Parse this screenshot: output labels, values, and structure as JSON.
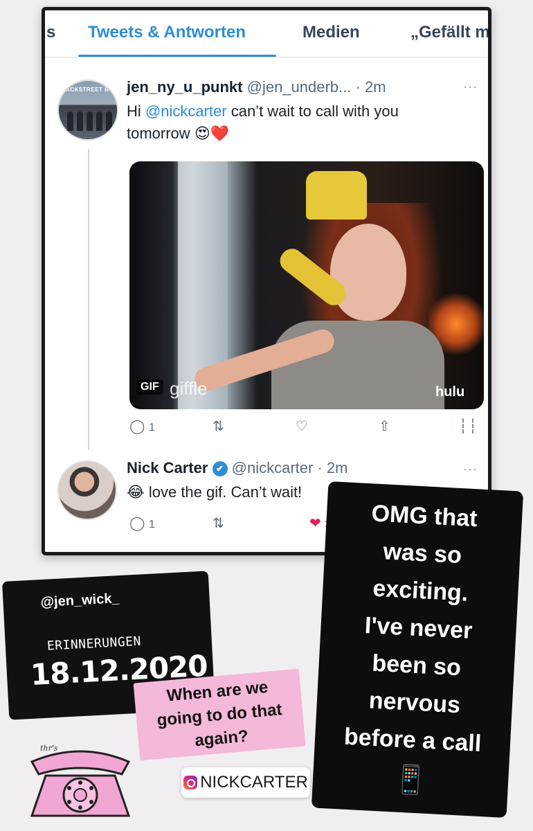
{
  "tabs": {
    "left_partial": "s",
    "tweets_replies": "Tweets & Antworten",
    "media": "Medien",
    "likes_partial": "„Gefällt m"
  },
  "tweet1": {
    "avatar_banner": "ACKSTREET B",
    "display_name": "jen_ny_u_punkt",
    "handle": "@jen_underb...",
    "time": "· 2m",
    "more": "···",
    "text_before": "Hi ",
    "mention": "@nickcarter",
    "text_after": " can’t wait to call with you",
    "text_line2": "tomorrow",
    "emoji": "😍❤️",
    "gif_badge": "GIF",
    "gif_watermark": "giffle",
    "gif_brand": "hulu",
    "reply_count": "1"
  },
  "tweet2": {
    "display_name": "Nick Carter",
    "verified": "✔",
    "handle": "@nickcarter",
    "time": "· 2m",
    "more": "···",
    "emoji": "😂",
    "text": "love the gif. Can’t wait!",
    "reply_count": "1",
    "like_count": "3"
  },
  "story": {
    "caption": "OMG that was so exciting. I've never been so nervous before a call",
    "caption_lines": [
      "OMG that",
      "was so",
      "exciting.",
      "I've never",
      "been so",
      "nervous",
      "before a call"
    ],
    "phone_emoji": "📱",
    "user_tag": "@jen_wick_",
    "memories_label": "ERINNERUNGEN",
    "memories_date": "18.12.2020",
    "question_lines": [
      "When are we",
      "going to do that",
      "again?"
    ],
    "mention_sticker": "NICKCARTER",
    "scribble": "thr's"
  },
  "colors": {
    "twitter_blue": "#2d8ed6",
    "like_red": "#e0245e",
    "sticker_pink": "#f4b8d9",
    "phone_pink": "#f2a6d4"
  }
}
